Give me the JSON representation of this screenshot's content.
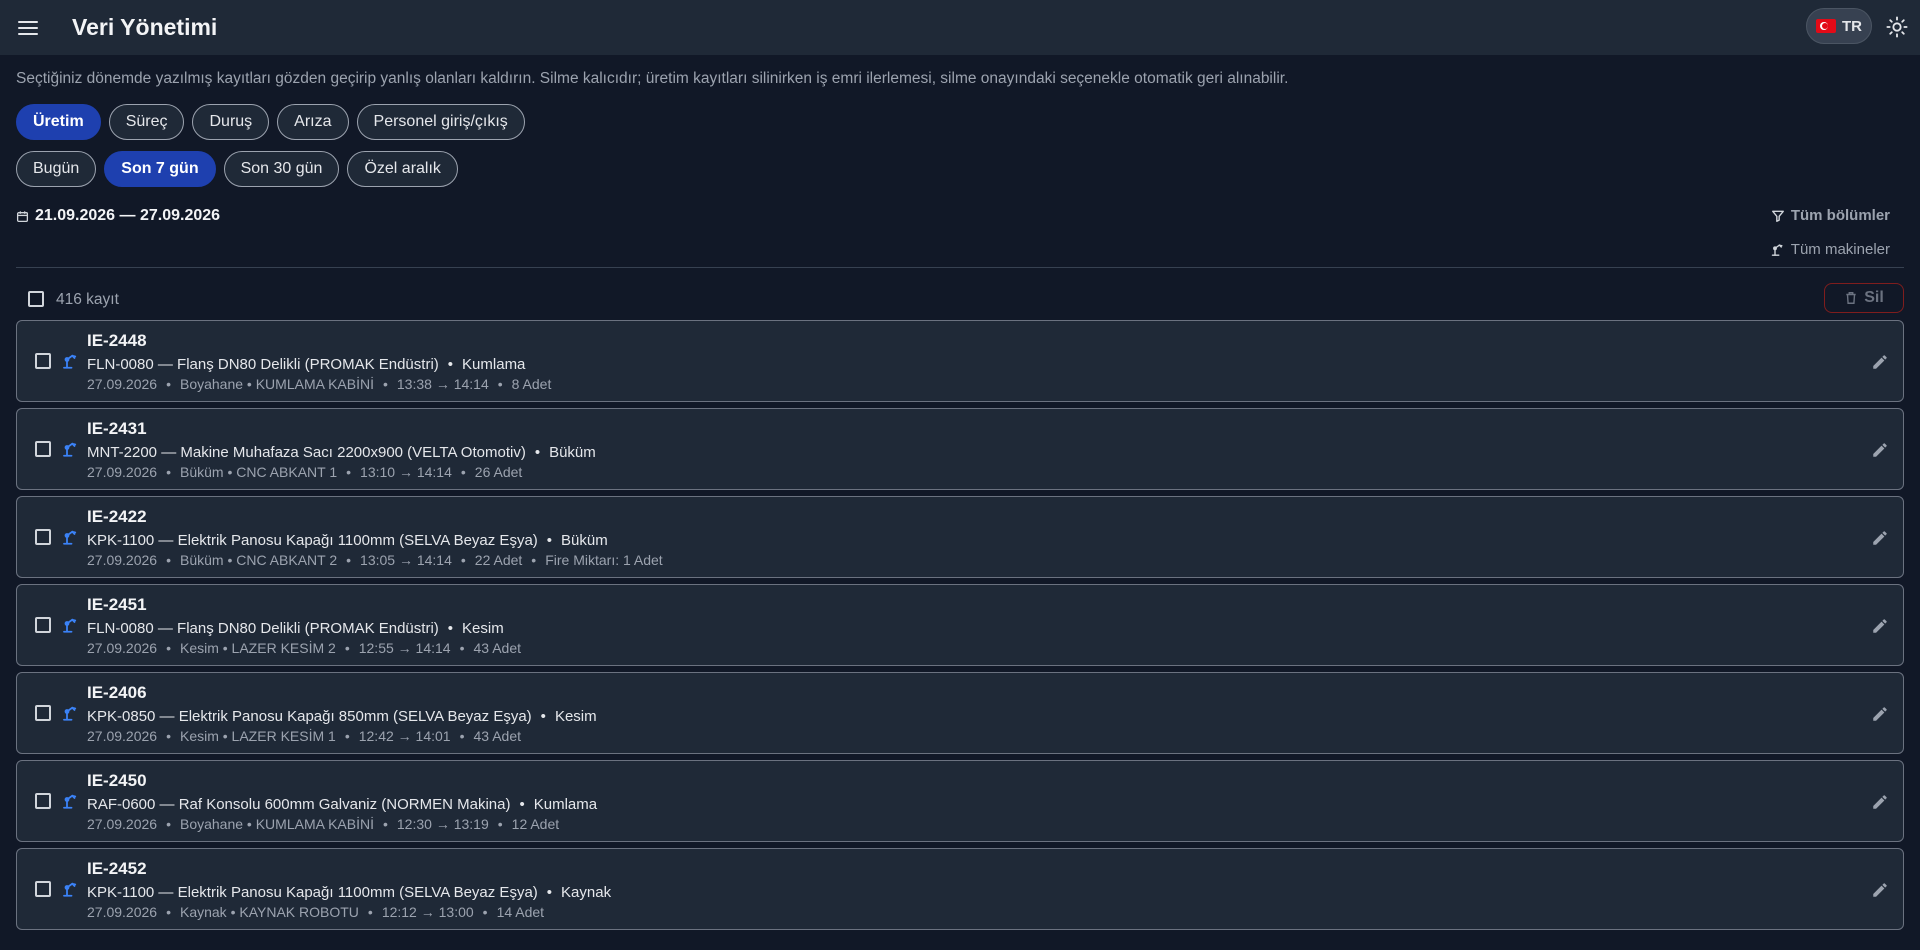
{
  "header": {
    "title": "Veri Yönetimi",
    "lang": "TR"
  },
  "description": "Seçtiğiniz dönemde yazılmış kayıtları gözden geçirip yanlış olanları kaldırın. Silme kalıcıdır; üretim kayıtları silinirken iş emri ilerlemesi, silme onayındaki seçenekle otomatik geri alınabilir.",
  "type_tabs": [
    {
      "label": "Üretim",
      "active": true
    },
    {
      "label": "Süreç",
      "active": false
    },
    {
      "label": "Duruş",
      "active": false
    },
    {
      "label": "Arıza",
      "active": false
    },
    {
      "label": "Personel giriş/çıkış",
      "active": false
    }
  ],
  "range_tabs": [
    {
      "label": "Bugün",
      "active": false
    },
    {
      "label": "Son 7 gün",
      "active": true
    },
    {
      "label": "Son 30 gün",
      "active": false
    },
    {
      "label": "Özel aralık",
      "active": false
    }
  ],
  "date_range": "21.09.2026 — 27.09.2026",
  "filters": {
    "sections": "Tüm bölümler",
    "machines": "Tüm makineler"
  },
  "list": {
    "count": "416 kayıt",
    "delete_label": "Sil"
  },
  "records": [
    {
      "id": "IE-2448",
      "product": "FLN-0080 — Flanş DN80 Delikli  (PROMAK Endüstri)",
      "process": "Kumlama",
      "date": "27.09.2026",
      "location": "Boyahane • KUMLAMA KABİNİ",
      "time": "13:38 → 14:14",
      "qty": "8 Adet",
      "extra": ""
    },
    {
      "id": "IE-2431",
      "product": "MNT-2200 — Makine Muhafaza Sacı 2200x900  (VELTA Otomotiv)",
      "process": "Büküm",
      "date": "27.09.2026",
      "location": "Büküm • CNC ABKANT 1",
      "time": "13:10 → 14:14",
      "qty": "26 Adet",
      "extra": ""
    },
    {
      "id": "IE-2422",
      "product": "KPK-1100 — Elektrik Panosu Kapağı 1100mm  (SELVA Beyaz Eşya)",
      "process": "Büküm",
      "date": "27.09.2026",
      "location": "Büküm • CNC ABKANT 2",
      "time": "13:05 → 14:14",
      "qty": "22 Adet",
      "extra": "Fire Miktarı: 1 Adet"
    },
    {
      "id": "IE-2451",
      "product": "FLN-0080 — Flanş DN80 Delikli  (PROMAK Endüstri)",
      "process": "Kesim",
      "date": "27.09.2026",
      "location": "Kesim • LAZER KESİM 2",
      "time": "12:55 → 14:14",
      "qty": "43 Adet",
      "extra": ""
    },
    {
      "id": "IE-2406",
      "product": "KPK-0850 — Elektrik Panosu Kapağı 850mm  (SELVA Beyaz Eşya)",
      "process": "Kesim",
      "date": "27.09.2026",
      "location": "Kesim • LAZER KESİM 1",
      "time": "12:42 → 14:01",
      "qty": "43 Adet",
      "extra": ""
    },
    {
      "id": "IE-2450",
      "product": "RAF-0600 — Raf Konsolu 600mm Galvaniz  (NORMEN Makina)",
      "process": "Kumlama",
      "date": "27.09.2026",
      "location": "Boyahane • KUMLAMA KABİNİ",
      "time": "12:30 → 13:19",
      "qty": "12 Adet",
      "extra": ""
    },
    {
      "id": "IE-2452",
      "product": "KPK-1100 — Elektrik Panosu Kapağı 1100mm  (SELVA Beyaz Eşya)",
      "process": "Kaynak",
      "date": "27.09.2026",
      "location": "Kaynak • KAYNAK ROBOTU",
      "time": "12:12 → 13:00",
      "qty": "14 Adet",
      "extra": ""
    }
  ]
}
